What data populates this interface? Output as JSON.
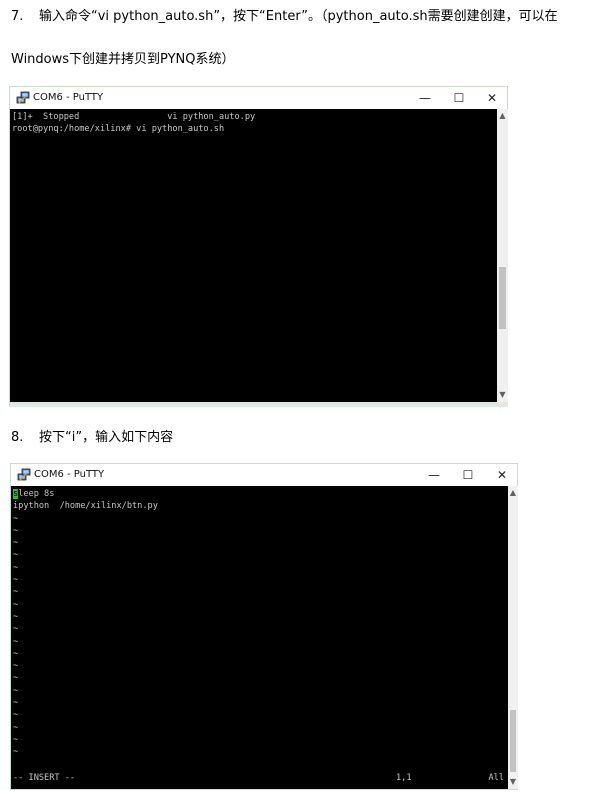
{
  "step7": {
    "number": "7.",
    "line1": "输入命令“vi python_auto.sh”，按下“Enter”。（python_auto.sh需要创建创建，可以在",
    "line2": "Windows下创建并拷贝到PYNQ系统）"
  },
  "step8": {
    "number": "8.",
    "text": "按下“i”，输入如下内容"
  },
  "window1": {
    "title": "COM6 - PuTTY",
    "minimize": "—",
    "maximize": "☐",
    "close": "✕",
    "terminal_lines": [
      "[1]+  Stopped                 vi python_auto.py",
      "root@pynq:/home/xilinx# vi python_auto.sh"
    ]
  },
  "window2": {
    "title": "COM6 - PuTTY",
    "minimize": "—",
    "maximize": "☐",
    "close": "✕",
    "cursor_char": "s",
    "line1_rest": "leep 8s",
    "line2": "ipython  /home/xilinx/btn.py",
    "tilde": "~",
    "status_mode": "-- INSERT --",
    "status_pos": "1,1",
    "status_all": "All"
  },
  "icons": {
    "putty": "putty-icon",
    "scroll_up": "scroll-up-arrow-icon",
    "scroll_down": "scroll-down-arrow-icon"
  }
}
